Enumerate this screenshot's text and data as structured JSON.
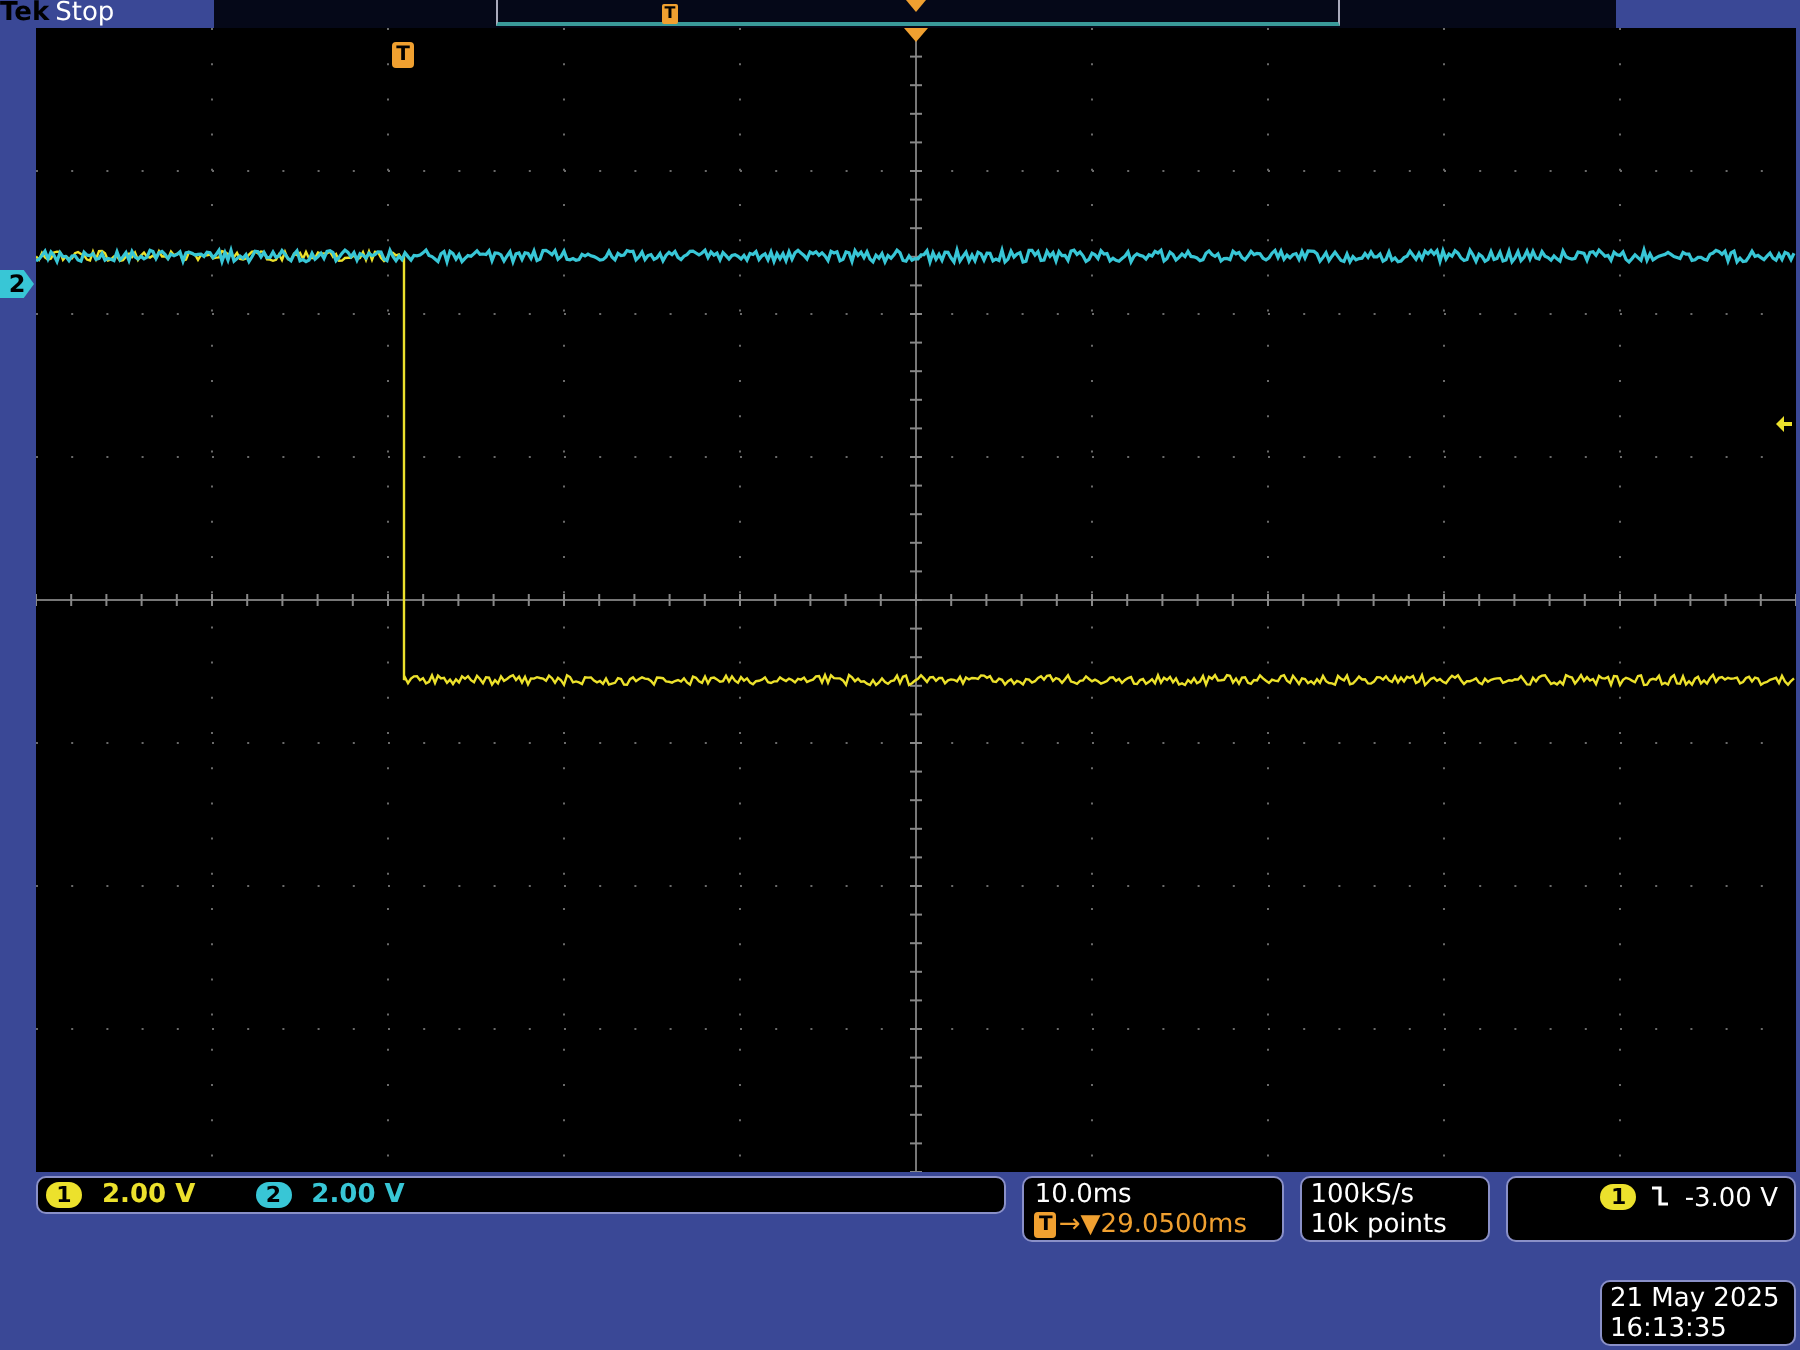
{
  "header": {
    "brand": "Tek",
    "status": "Stop"
  },
  "record_view": {
    "trigger_marker": "T"
  },
  "waveform_area": {
    "trigger_marker": "T",
    "channel_marker": {
      "label": "2",
      "color": "#38c6d6"
    }
  },
  "channels": [
    {
      "label": "1",
      "scale": "2.00 V",
      "color": "#ece12c"
    },
    {
      "label": "2",
      "scale": "2.00 V",
      "color": "#38c6d6"
    }
  ],
  "timebase": {
    "scale": "10.0ms",
    "trigger_badge": "T",
    "position": "→▼29.0500ms"
  },
  "acquisition": {
    "sample_rate": "100kS/s",
    "record_length": "10k points"
  },
  "trigger": {
    "source": "1",
    "level": "-3.00 V",
    "color": "#ece12c"
  },
  "datetime": {
    "date": "21 May 2025",
    "time": "16:13:35"
  }
}
